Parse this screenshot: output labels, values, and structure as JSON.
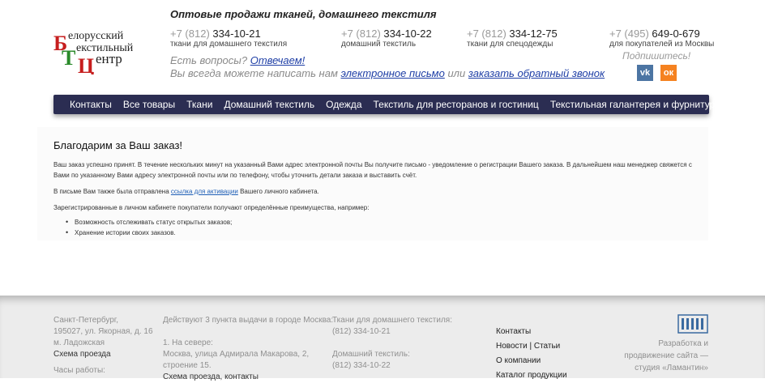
{
  "header": {
    "tagline": "Оптовые продажи тканей, домашнего текстиля",
    "logo": {
      "line1": "елорусский",
      "line2": "екстильный",
      "line3": "ентр",
      "letters": "БТЦ"
    },
    "phones": [
      {
        "code": "+7 (812)",
        "number": "334-10-21",
        "label": "ткани для домашнего текстиля"
      },
      {
        "code": "+7 (812)",
        "number": "334-10-22",
        "label": "домашний текстиль"
      },
      {
        "code": "+7 (812)",
        "number": "334-12-75",
        "label": "ткани для спецодежды"
      },
      {
        "code": "+7 (495)",
        "number": "649-0-679",
        "label": "для покупателей из Москвы"
      }
    ],
    "question": "Есть вопросы?",
    "answer_link": "Отвечаем!",
    "write_prefix": "Вы всегда можете написать нам",
    "email_link": "электронное письмо",
    "or_text": "или",
    "callback_link": "заказать обратный звонок",
    "subscribe": "Подпишитесь!",
    "social": [
      {
        "icon": "vk-icon",
        "glyph": "vk",
        "color": "#4c75a3"
      },
      {
        "icon": "odnoklassniki-icon",
        "glyph": "ок",
        "color": "#f58220"
      }
    ]
  },
  "nav": {
    "items": [
      "Контакты",
      "Все товары",
      "Ткани",
      "Домашний текстиль",
      "Одежда",
      "Текстиль для ресторанов и гостиниц",
      "Текстильная галантерея и фурнитура"
    ]
  },
  "main": {
    "title": "Благодарим за Ваш заказ!",
    "p1": "Ваш заказ успешно принят. В течение нескольких минут на указанный Вами адрес электронной почты Вы получите письмо - уведомление о регистрации Вашего заказа. В дальнейшем наш менеджер свяжется с Вами по указанному Вами адресу электронной почты или по телефону, чтобы уточнить детали заказа и выставить счёт.",
    "p2_before": "В письме Вам также была отправлена",
    "p2_link": "ссылка для активации",
    "p2_after": "Вашего личного кабинета.",
    "p3": "Зарегистрированные в личном кабинете покупатели получают определённые преимущества, например:",
    "bullets": [
      "Возможность отслеживать статус открытых заказов;",
      "Хранение истории своих заказов."
    ]
  },
  "footer": {
    "address": [
      "Санкт-Петербург,",
      "195027, ул. Якорная, д. 16",
      "м. Ладожская"
    ],
    "map_link": "Схема проезда",
    "hours": "Часы работы:",
    "points_title": "Действуют 3 пункта выдачи в городе Москва:",
    "point1_title": "1. На севере:",
    "point1_addr": [
      "Москва, улица Адмирала Макарова, 2,",
      "строение 15."
    ],
    "point1_link": "Схема проезда, контакты",
    "phone1_label": "Ткани для домашнего текстиля:",
    "phone1": "(812) 334-10-21",
    "phone2_label": "Домашний текстиль:",
    "phone2": "(812) 334-10-22",
    "menu": [
      "Контакты",
      "Новости | Статьи",
      "О компании",
      "Каталог продукции"
    ],
    "dev_text": [
      "Разработка и",
      "продвижение сайта —",
      "студия «Ламантин»"
    ]
  }
}
